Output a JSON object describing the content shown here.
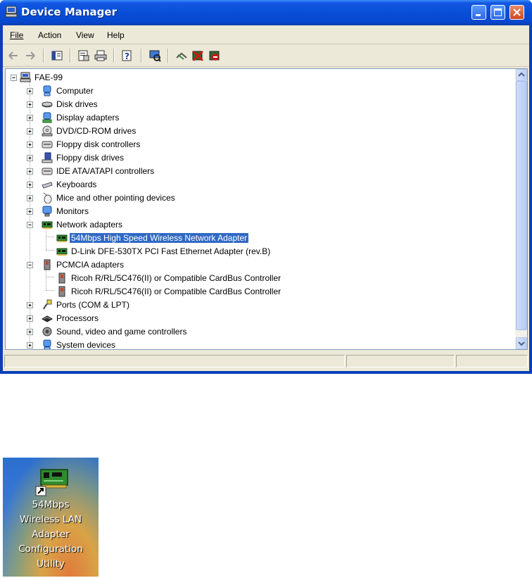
{
  "window": {
    "title": "Device Manager",
    "buttons": [
      "minimize",
      "maximize",
      "close"
    ]
  },
  "menu": [
    {
      "label": "File"
    },
    {
      "label": "Action"
    },
    {
      "label": "View"
    },
    {
      "label": "Help"
    }
  ],
  "toolbar": {
    "icons": [
      "back-arrow-icon",
      "forward-arrow-icon",
      "show-hide-tree-icon",
      "properties-icon",
      "print-icon",
      "help-icon",
      "scan-hardware-icon",
      "update-driver-icon",
      "uninstall-icon",
      "disable-icon"
    ]
  },
  "tree": {
    "root": "FAE-99",
    "categories": [
      {
        "label": "Computer"
      },
      {
        "label": "Disk drives"
      },
      {
        "label": "Display adapters"
      },
      {
        "label": "DVD/CD-ROM drives"
      },
      {
        "label": "Floppy disk controllers"
      },
      {
        "label": "Floppy disk drives"
      },
      {
        "label": "IDE ATA/ATAPI controllers"
      },
      {
        "label": "Keyboards"
      },
      {
        "label": "Mice and other pointing devices"
      },
      {
        "label": "Monitors"
      },
      {
        "label": "Network adapters",
        "expanded": true,
        "children": [
          {
            "label": "54Mbps High Speed Wireless Network Adapter",
            "selected": true
          },
          {
            "label": "D-Link DFE-530TX PCI Fast Ethernet Adapter (rev.B)"
          }
        ]
      },
      {
        "label": "PCMCIA adapters",
        "expanded": true,
        "children": [
          {
            "label": "Ricoh R/RL/5C476(II) or Compatible CardBus Controller"
          },
          {
            "label": "Ricoh R/RL/5C476(II) or Compatible CardBus Controller"
          }
        ]
      },
      {
        "label": "Ports (COM & LPT)"
      },
      {
        "label": "Processors"
      },
      {
        "label": "Sound, video and game controllers"
      },
      {
        "label": "System devices"
      }
    ]
  },
  "desktop_shortcut": {
    "lines": [
      "54Mbps",
      "Wireless LAN",
      "Adapter",
      "Configuration",
      "Utility"
    ]
  }
}
